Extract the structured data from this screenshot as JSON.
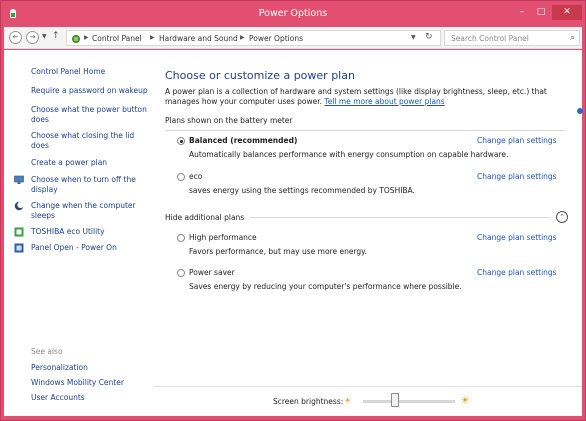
{
  "window": {
    "title": "Power Options",
    "min": "–",
    "max": "□",
    "close": "✕"
  },
  "address": {
    "crumbs": [
      "Control Panel",
      "Hardware and Sound",
      "Power Options"
    ],
    "search_placeholder": "Search Control Panel"
  },
  "sidebar": {
    "items": [
      {
        "label": "Control Panel Home"
      },
      {
        "label": "Require a password on wakeup"
      },
      {
        "label": "Choose what the power button does"
      },
      {
        "label": "Choose what closing the lid does"
      },
      {
        "label": "Create a power plan"
      },
      {
        "label": "Choose when to turn off the display"
      },
      {
        "label": "Change when the computer sleeps"
      },
      {
        "label": "TOSHIBA eco Utility"
      },
      {
        "label": "Panel Open - Power On"
      }
    ],
    "see_also": "See also",
    "see_also_items": [
      "Personalization",
      "Windows Mobility Center",
      "User Accounts"
    ]
  },
  "main": {
    "heading": "Choose or customize a power plan",
    "intro": "A power plan is a collection of hardware and system settings (like display brightness, sleep, etc.) that manages how your computer uses power.",
    "intro_link": "Tell me more about power plans",
    "section_battery": "Plans shown on the battery meter",
    "section_hidden": "Hide additional plans",
    "change_label": "Change plan settings",
    "plans": [
      {
        "name": "Balanced (recommended)",
        "desc": "Automatically balances performance with energy consumption on capable hardware.",
        "selected": true
      },
      {
        "name": "eco",
        "desc": "saves energy using the settings recommended by TOSHIBA.",
        "selected": false
      },
      {
        "name": "High performance",
        "desc": "Favors performance, but may use more energy.",
        "selected": false
      },
      {
        "name": "Power saver",
        "desc": "Saves energy by reducing your computer's performance where possible.",
        "selected": false
      }
    ]
  },
  "brightness": {
    "label": "Screen brightness:",
    "level_fraction": 0.35
  },
  "colors": {
    "titlebar": "#e24f70",
    "link": "#1f55b7",
    "heading": "#1f3f8a"
  }
}
